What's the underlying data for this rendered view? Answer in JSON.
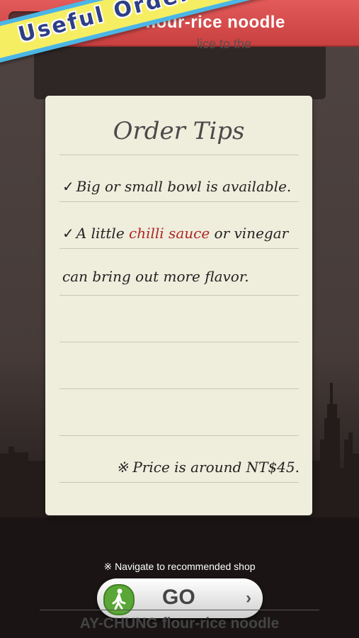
{
  "header": {
    "title": "AY-CHUNG flour-rice noodle",
    "subline": "lice to the"
  },
  "banner": {
    "text": "Useful Order Tips"
  },
  "note": {
    "title": "Order Tips",
    "lines": [
      {
        "text": "Big or small bowl is available.",
        "check": "✓"
      },
      {
        "check": "✓",
        "pre": "A little ",
        "highlight": "chilli sauce",
        "post": " or vinegar"
      },
      {
        "text": "can bring out more flavor."
      }
    ],
    "price": "※ Price is around NT$45."
  },
  "bottom": {
    "hint": "※ Navigate to recommended shop",
    "go_label": "GO",
    "chevron": "›",
    "shop_name": "AY-CHUNG flour-rice noodle"
  },
  "colors": {
    "header_red": "#d94c4c",
    "ribbon_yellow": "#f5ee63",
    "ribbon_blue": "#4bb6e6",
    "note_bg": "#efeddc",
    "highlight_red": "#b02525"
  },
  "icons": [
    "back-arrow-icon",
    "walking-person-icon",
    "chevron-right-icon"
  ]
}
